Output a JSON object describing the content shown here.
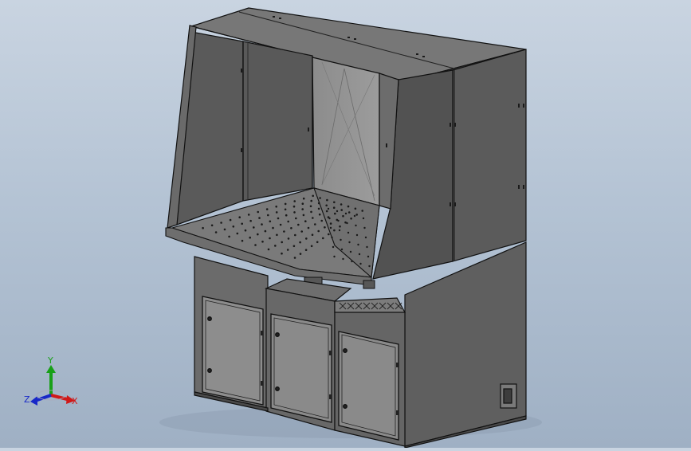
{
  "triad": {
    "x_label": "X",
    "y_label": "Y",
    "z_label": "Z",
    "x_color": "#d01818",
    "y_color": "#18a018",
    "z_color": "#1828c8"
  },
  "model": {
    "body_color": "#5e5e5e",
    "panel_color": "#6e6e6e",
    "edge_color": "#111111",
    "door_color": "#8a8a8a",
    "perforation_color": "#1a1a1a"
  }
}
